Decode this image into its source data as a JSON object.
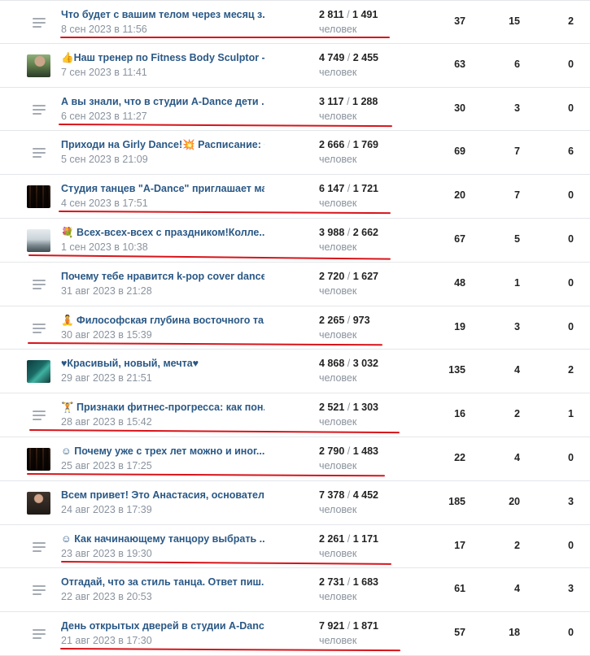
{
  "people_label": "человек",
  "underline_color": "#d8141a",
  "posts": [
    {
      "thumb": "text",
      "title": "Что будет с вашим телом через месяц з...",
      "date": "8 сен 2023 в 11:56",
      "reach": "2 811",
      "reach_sub": "1 491",
      "c1": "37",
      "c2": "15",
      "c3": "2",
      "underlined": true
    },
    {
      "thumb": "photo-trainer",
      "title": "👍Наш тренер по Fitness Body Sculptor - ...",
      "date": "7 сен 2023 в 11:41",
      "reach": "4 749",
      "reach_sub": "2 455",
      "c1": "63",
      "c2": "6",
      "c3": "0",
      "underlined": false
    },
    {
      "thumb": "text",
      "title": "А вы знали, что в студии A-Dance дети ...",
      "date": "6 сен 2023 в 11:27",
      "reach": "3 117",
      "reach_sub": "1 288",
      "c1": "30",
      "c2": "3",
      "c3": "0",
      "underlined": true
    },
    {
      "thumb": "text",
      "title": "Приходи на Girly Dance!💥 Расписание: •...",
      "date": "5 сен 2023 в 21:09",
      "reach": "2 666",
      "reach_sub": "1 769",
      "c1": "69",
      "c2": "7",
      "c3": "6",
      "underlined": false
    },
    {
      "thumb": "photo-studio",
      "title": "Студия танцев \"A-Dance\" приглашает ма...",
      "date": "4 сен 2023 в 17:51",
      "reach": "6 147",
      "reach_sub": "1 721",
      "c1": "20",
      "c2": "7",
      "c3": "0",
      "underlined": true
    },
    {
      "thumb": "photo-group",
      "title": "💐 Всех-всех-всех с праздником!Колле...",
      "date": "1 сен 2023 в 10:38",
      "reach": "3 988",
      "reach_sub": "2 662",
      "c1": "67",
      "c2": "5",
      "c3": "0",
      "underlined": true
    },
    {
      "thumb": "text",
      "title": "Почему тебе нравится k-pop cover dance...",
      "date": "31 авг 2023 в 21:28",
      "reach": "2 720",
      "reach_sub": "1 627",
      "c1": "48",
      "c2": "1",
      "c3": "0",
      "underlined": false
    },
    {
      "thumb": "text",
      "title": "🧘 Философская глубина восточного та...",
      "date": "30 авг 2023 в 15:39",
      "reach": "2 265",
      "reach_sub": "973",
      "c1": "19",
      "c2": "3",
      "c3": "0",
      "underlined": true
    },
    {
      "thumb": "photo-teal",
      "title": "♥Красивый, новый, мечта♥",
      "date": "29 авг 2023 в 21:51",
      "reach": "4 868",
      "reach_sub": "3 032",
      "c1": "135",
      "c2": "4",
      "c3": "2",
      "underlined": false
    },
    {
      "thumb": "text",
      "title": "🏋 Признаки фитнес-прогресса: как пон...",
      "date": "28 авг 2023 в 15:42",
      "reach": "2 521",
      "reach_sub": "1 303",
      "c1": "16",
      "c2": "2",
      "c3": "1",
      "underlined": true
    },
    {
      "thumb": "photo-studio",
      "title": "☺ Почему уже с трех лет можно и иног...",
      "date": "25 авг 2023 в 17:25",
      "reach": "2 790",
      "reach_sub": "1 483",
      "c1": "22",
      "c2": "4",
      "c3": "0",
      "underlined": true
    },
    {
      "thumb": "photo-dancer",
      "title": "Всем привет! Это Анастасия, основател...",
      "date": "24 авг 2023 в 17:39",
      "reach": "7 378",
      "reach_sub": "4 452",
      "c1": "185",
      "c2": "20",
      "c3": "3",
      "underlined": false
    },
    {
      "thumb": "text",
      "title": "☺ Как начинающему танцору выбрать ...",
      "date": "23 авг 2023 в 19:30",
      "reach": "2 261",
      "reach_sub": "1 171",
      "c1": "17",
      "c2": "2",
      "c3": "0",
      "underlined": true
    },
    {
      "thumb": "text",
      "title": "Отгадай, что за стиль танца. Ответ пиш...",
      "date": "22 авг 2023 в 20:53",
      "reach": "2 731",
      "reach_sub": "1 683",
      "c1": "61",
      "c2": "4",
      "c3": "3",
      "underlined": false
    },
    {
      "thumb": "text",
      "title": "День открытых дверей в студии A-Danc...",
      "date": "21 авг 2023 в 17:30",
      "reach": "7 921",
      "reach_sub": "1 871",
      "c1": "57",
      "c2": "18",
      "c3": "0",
      "underlined": true
    }
  ]
}
